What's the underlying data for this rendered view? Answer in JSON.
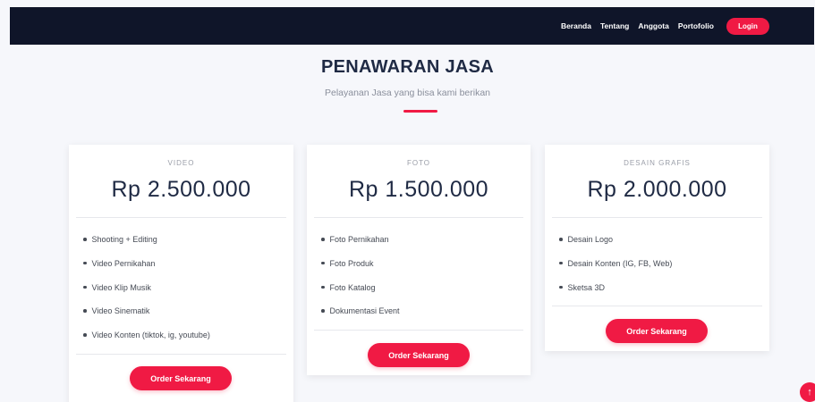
{
  "nav": {
    "links": [
      "Beranda",
      "Tentang",
      "Anggota",
      "Portofolio"
    ],
    "login": "Login"
  },
  "section": {
    "title": "PENAWARAN JASA",
    "subtitle": "Pelayanan Jasa yang bisa kami berikan"
  },
  "cards": [
    {
      "name": "VIDEO",
      "price": "Rp 2.500.000",
      "features": [
        "Shooting + Editing",
        "Video Pernikahan",
        "Video Klip Musik",
        "Video Sinematik",
        "Video Konten (tiktok, ig, youtube)"
      ],
      "button": "Order Sekarang"
    },
    {
      "name": "FOTO",
      "price": "Rp 1.500.000",
      "features": [
        "Foto Pernikahan",
        "Foto Produk",
        "Foto Katalog",
        "Dokumentasi Event"
      ],
      "button": "Order Sekarang"
    },
    {
      "name": "DESAIN GRAFIS",
      "price": "Rp 2.000.000",
      "features": [
        "Desain Logo",
        "Desain Konten (IG, FB, Web)",
        "Sketsa 3D"
      ],
      "button": "Order Sekarang"
    }
  ],
  "colors": {
    "accent": "#f01a44",
    "navbar": "#0f1529",
    "heading": "#1f2a44"
  },
  "icons": {
    "scroll_top": "arrow-up-icon"
  }
}
